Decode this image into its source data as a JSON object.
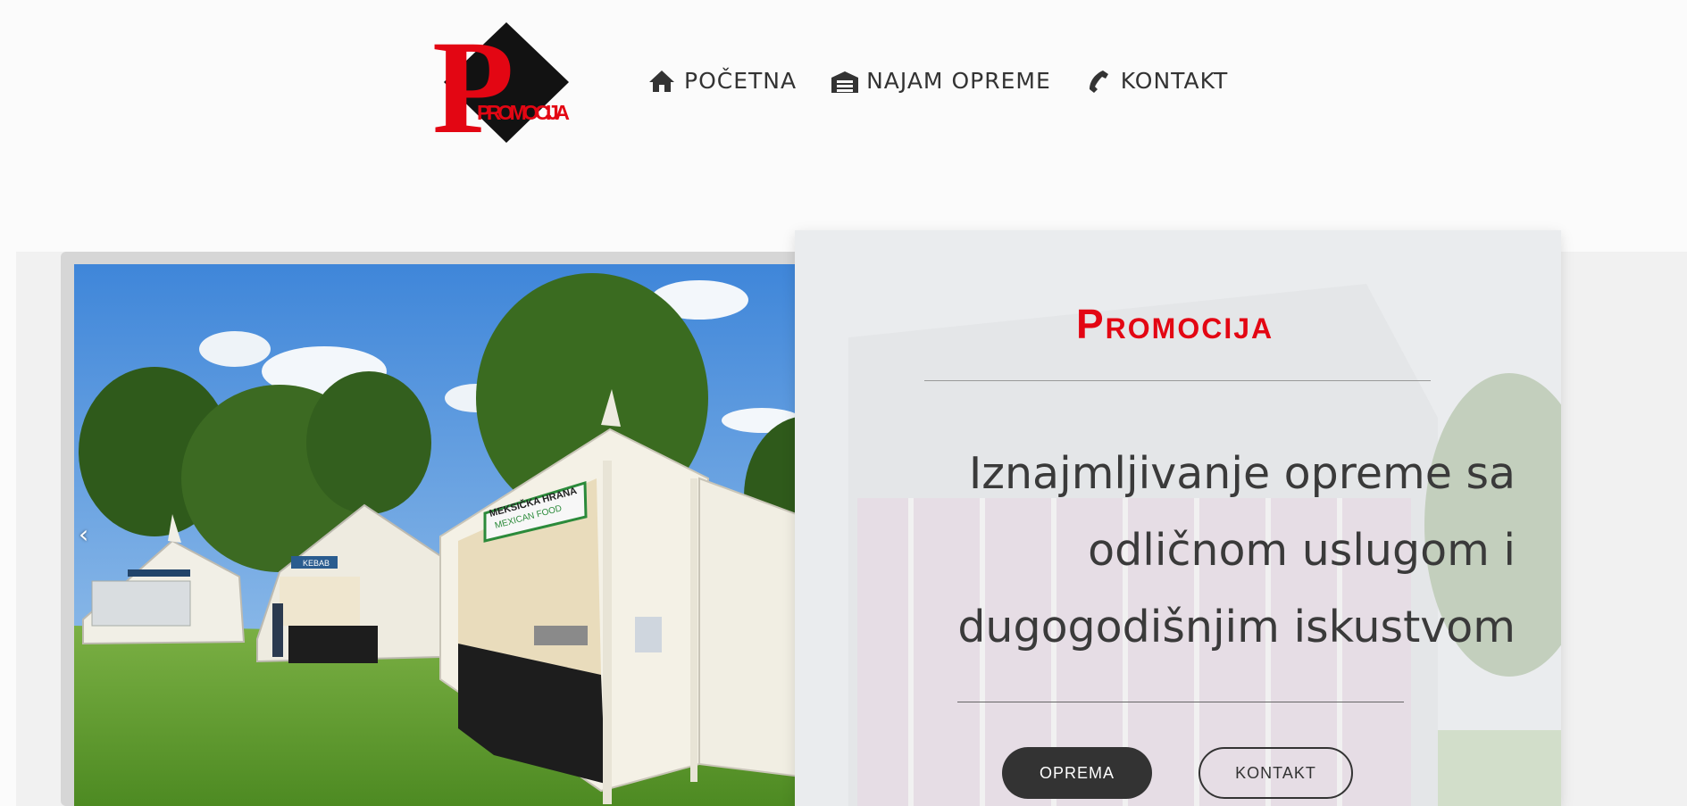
{
  "logo": {
    "text": "PROMOCIJA",
    "initial": "P"
  },
  "nav": {
    "items": [
      {
        "label": "POČETNA",
        "icon": "home-icon"
      },
      {
        "label": "NAJAM OPREME",
        "icon": "garage-icon"
      },
      {
        "label": "KONTAKT",
        "icon": "phone-icon"
      }
    ]
  },
  "slider": {
    "prev_label": "‹",
    "next_label": "›",
    "signs": [
      "MEKSIČKA HRANA",
      "MEXICAN FOOD",
      "KEBAB"
    ]
  },
  "hero": {
    "brand": "Promocija",
    "tagline_lines": [
      "Iznajmljivanje opreme sa",
      "odličnom uslugom i",
      "dugogodišnjim iskustvom"
    ],
    "buttons": {
      "primary": "OPREMA",
      "secondary": "KONTAKT"
    }
  },
  "colors": {
    "brand_red": "#e30613",
    "dark": "#333333",
    "sky": "#87b6e6",
    "grass": "#5f9a2f"
  }
}
